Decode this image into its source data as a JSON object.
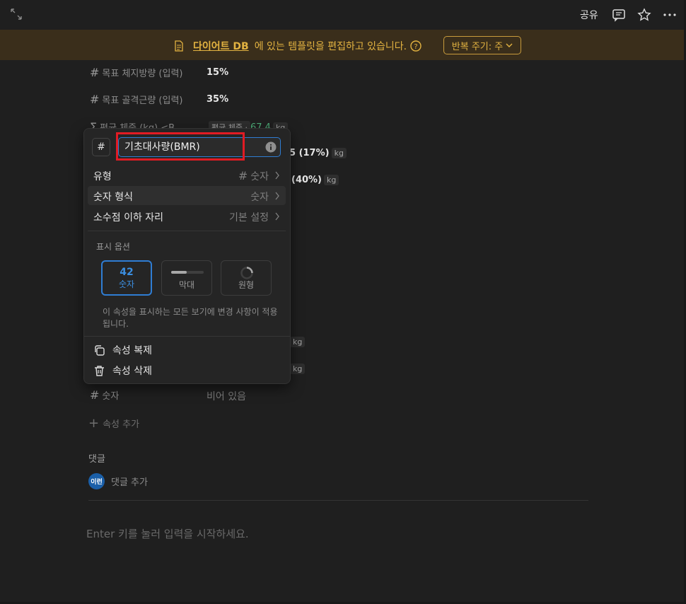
{
  "topbar": {
    "share": "공유"
  },
  "banner": {
    "db_name": "다이어트 DB",
    "text": "에 있는 템플릿을 편집하고 있습니다.",
    "repeat_button": "반복 주기: 주"
  },
  "properties": [
    {
      "name": "목표 체지방량 (입력)",
      "value": "15%"
    },
    {
      "name": "목표 골격근량 (입력)",
      "value": "35%"
    },
    {
      "name": "평균 체중 (kg) <B",
      "value_prefix": "평균 체중 · ",
      "value": "67.4",
      "unit": "kg"
    },
    {
      "value": "5 (17%)",
      "unit": "kg"
    },
    {
      "value": "(40%)",
      "unit": "kg"
    },
    {
      "unit": "kg"
    },
    {
      "unit": "kg"
    },
    {
      "name": "숫자",
      "value": "비어 있음"
    }
  ],
  "add_property": "속성 추가",
  "comments": {
    "title": "댓글",
    "avatar": "이런",
    "add": "댓글 추가"
  },
  "editor_hint": "Enter 키를 눌러 입력을 시작하세요.",
  "popup": {
    "name_value": "기초대사량(BMR)",
    "type_label": "유형",
    "type_value": "숫자",
    "format_label": "숫자 형식",
    "format_value": "숫자",
    "decimal_label": "소수점 이하 자리",
    "decimal_value": "기본 설정",
    "display_section": "표시 옵션",
    "options": [
      {
        "label": "숫자",
        "preview": "42",
        "selected": true
      },
      {
        "label": "막대",
        "selected": false
      },
      {
        "label": "원형",
        "selected": false
      }
    ],
    "hint": "이 속성을 표시하는 모든 보기에 변경 사항이 적용됩니다.",
    "duplicate": "속성 복제",
    "delete": "속성 삭제"
  },
  "colors": {
    "accent": "#2f7dd3",
    "banner_text": "#e3b341",
    "highlight": "#e11b24"
  }
}
